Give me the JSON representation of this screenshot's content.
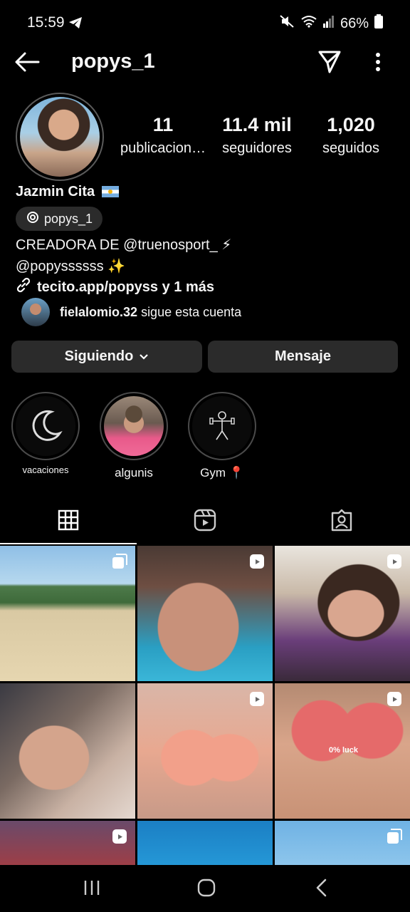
{
  "status_bar": {
    "time": "15:59",
    "battery": "66%",
    "icons": [
      "telegram-icon",
      "mute-icon",
      "wifi-icon",
      "signal-icon",
      "battery-icon"
    ]
  },
  "header": {
    "username": "popys_1",
    "icons": [
      "back-arrow-icon",
      "send-icon",
      "more-vertical-icon"
    ]
  },
  "profile": {
    "stats": [
      {
        "value": "11",
        "label": "publicacion…"
      },
      {
        "value": "11.4 mil",
        "label": "seguidores"
      },
      {
        "value": "1,020",
        "label": "seguidos"
      }
    ],
    "name": "Jazmin Cita",
    "threads_handle": "popys_1",
    "bio_line1": "CREADORA DE @truenosport_ ⚡",
    "bio_line2": "@popyssssss ✨",
    "link": "tecito.app/popyss y 1 más",
    "followed_by_user": "fielalomio.32",
    "followed_by_text": "sigue esta cuenta"
  },
  "actions": {
    "following_label": "Siguiendo",
    "message_label": "Mensaje"
  },
  "highlights": [
    {
      "label": "vacaciones",
      "icon": "moon-icon"
    },
    {
      "label": "algunis",
      "icon": "photo"
    },
    {
      "label": "Gym 📍",
      "icon": "gym-sketch-icon"
    }
  ],
  "tabs": [
    {
      "icon": "grid-icon",
      "active": true
    },
    {
      "icon": "reels-icon",
      "active": false
    },
    {
      "icon": "tagged-icon",
      "active": false
    }
  ],
  "posts": [
    {
      "badge": "carousel-icon"
    },
    {
      "badge": "reels-icon"
    },
    {
      "badge": "reels-icon"
    },
    {
      "badge": ""
    },
    {
      "badge": "reels-icon"
    },
    {
      "badge": "reels-icon"
    },
    {
      "badge": "reels-icon"
    },
    {
      "badge": ""
    },
    {
      "badge": "carousel-icon"
    }
  ],
  "post_overlay_text": "0% luck",
  "nav_bar": [
    "recents-icon",
    "home-icon",
    "back-icon"
  ]
}
